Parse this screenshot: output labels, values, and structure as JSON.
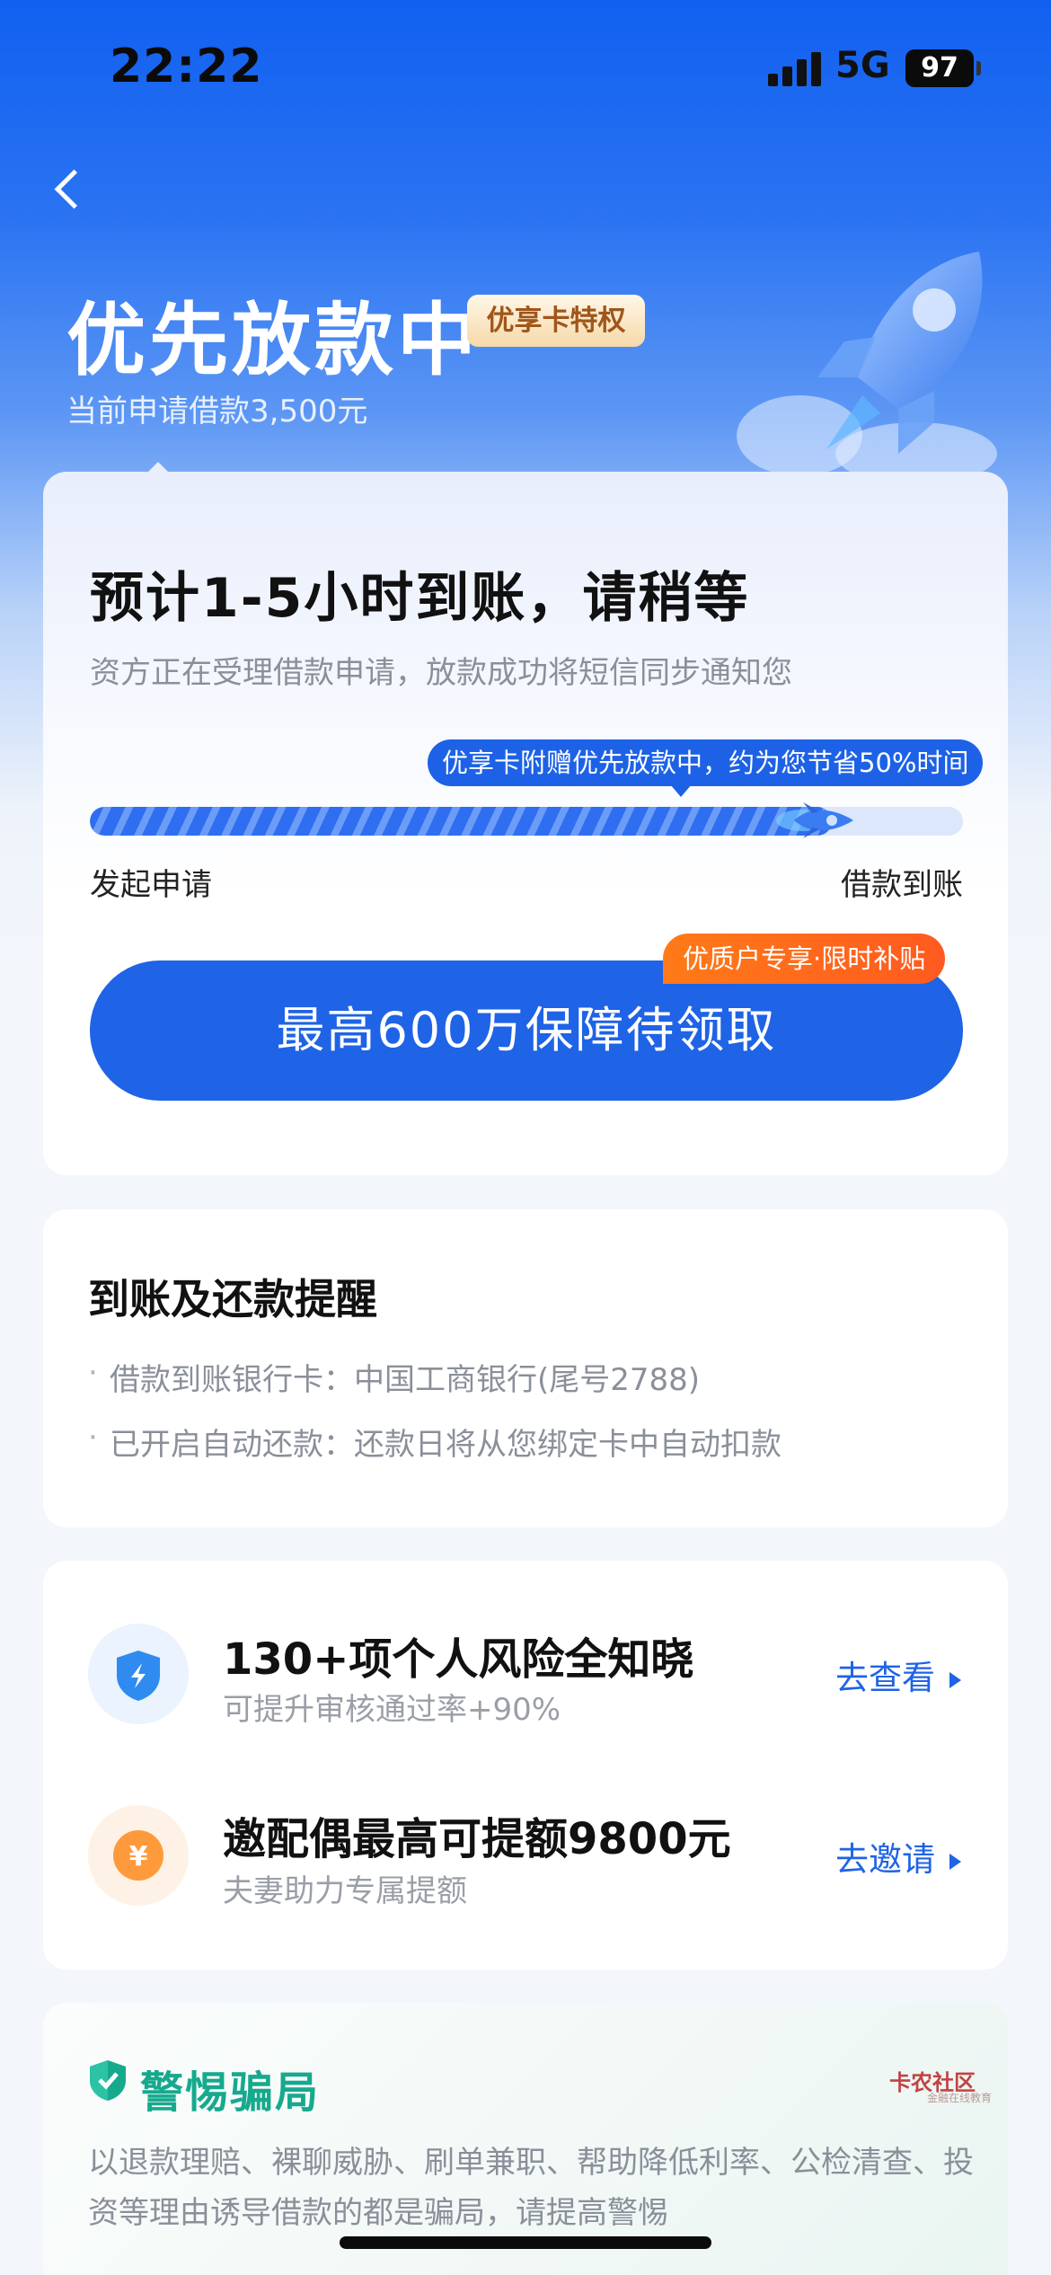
{
  "status_bar": {
    "time": "22:22",
    "network": "5G",
    "battery": "97"
  },
  "header": {
    "title": "优先放款中",
    "badge": "优享卡特权",
    "subtitle": "当前申请借款3,500元"
  },
  "progress_card": {
    "eta_title": "预计1-5小时到账，请稍等",
    "eta_desc": "资方正在受理借款申请，放款成功将短信同步通知您",
    "tip": "优享卡附赠优先放款中，约为您节省50%时间",
    "progress": 0.85,
    "step_start": "发起申请",
    "step_end": "借款到账",
    "promo_tag": "优质户专享·限时补贴",
    "cta_label": "最高600万保障待领取"
  },
  "reminder": {
    "title": "到账及还款提醒",
    "items": [
      {
        "label": "借款到账银行卡：",
        "value": "中国工商银行(尾号2788)"
      },
      {
        "label": "已开启自动还款：",
        "value": "还款日将从您绑定卡中自动扣款"
      }
    ]
  },
  "features": [
    {
      "title": "130+项个人风险全知晓",
      "subtitle": "可提升审核通过率+90%",
      "link": "去查看",
      "icon": "shield-lightning-icon",
      "color": "#2f8bf0"
    },
    {
      "title": "邀配偶最高可提额9800元",
      "subtitle": "夫妻助力专属提额",
      "link": "去邀请",
      "icon": "yen-coin-icon",
      "color": "#ff9a3c"
    }
  ],
  "warning": {
    "title": "警惕骗局",
    "text": "以退款理赔、裸聊威胁、刷单兼职、帮助降低利率、公检清查、投资等理由诱导借款的都是骗局，请提高警惕"
  },
  "watermark": {
    "text": "卡农社区",
    "sub": "金融在线教育"
  },
  "colors": {
    "primary": "#1f63e6",
    "warning_green": "#17a98e",
    "promo_orange": "#ff6a1c"
  }
}
